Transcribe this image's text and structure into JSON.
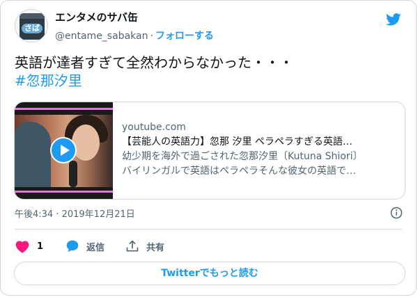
{
  "account": {
    "name": "エンタメのサバ缶",
    "avatar_text": "さば",
    "handle": "@entame_sabakan",
    "separator": "·",
    "follow_label": "フォローする"
  },
  "tweet": {
    "text": "英語が達者すぎて全然わからなかった・・・",
    "hashtag": "#忽那汐里"
  },
  "link_card": {
    "domain": "youtube.com",
    "title": "【芸能人の英語力】忽那 汐里 ペラペラすぎる英語…",
    "description_line1": "幼少期を海外で過ごされた忽那汐里〔Kutuna Shiori〕",
    "description_line2": "バイリンガルで英語はペラペラそんな彼女の英語で…"
  },
  "timestamp": "午後4:34 · 2019年12月21日",
  "actions": {
    "like_count": "1",
    "reply_label": "返信",
    "share_label": "共有"
  },
  "read_more_label": "Twitterでもっと読む",
  "colors": {
    "accent": "#1d9bf0",
    "like": "#f91880",
    "text": "#0f1419",
    "muted": "#536471",
    "border": "#cfd9de"
  }
}
